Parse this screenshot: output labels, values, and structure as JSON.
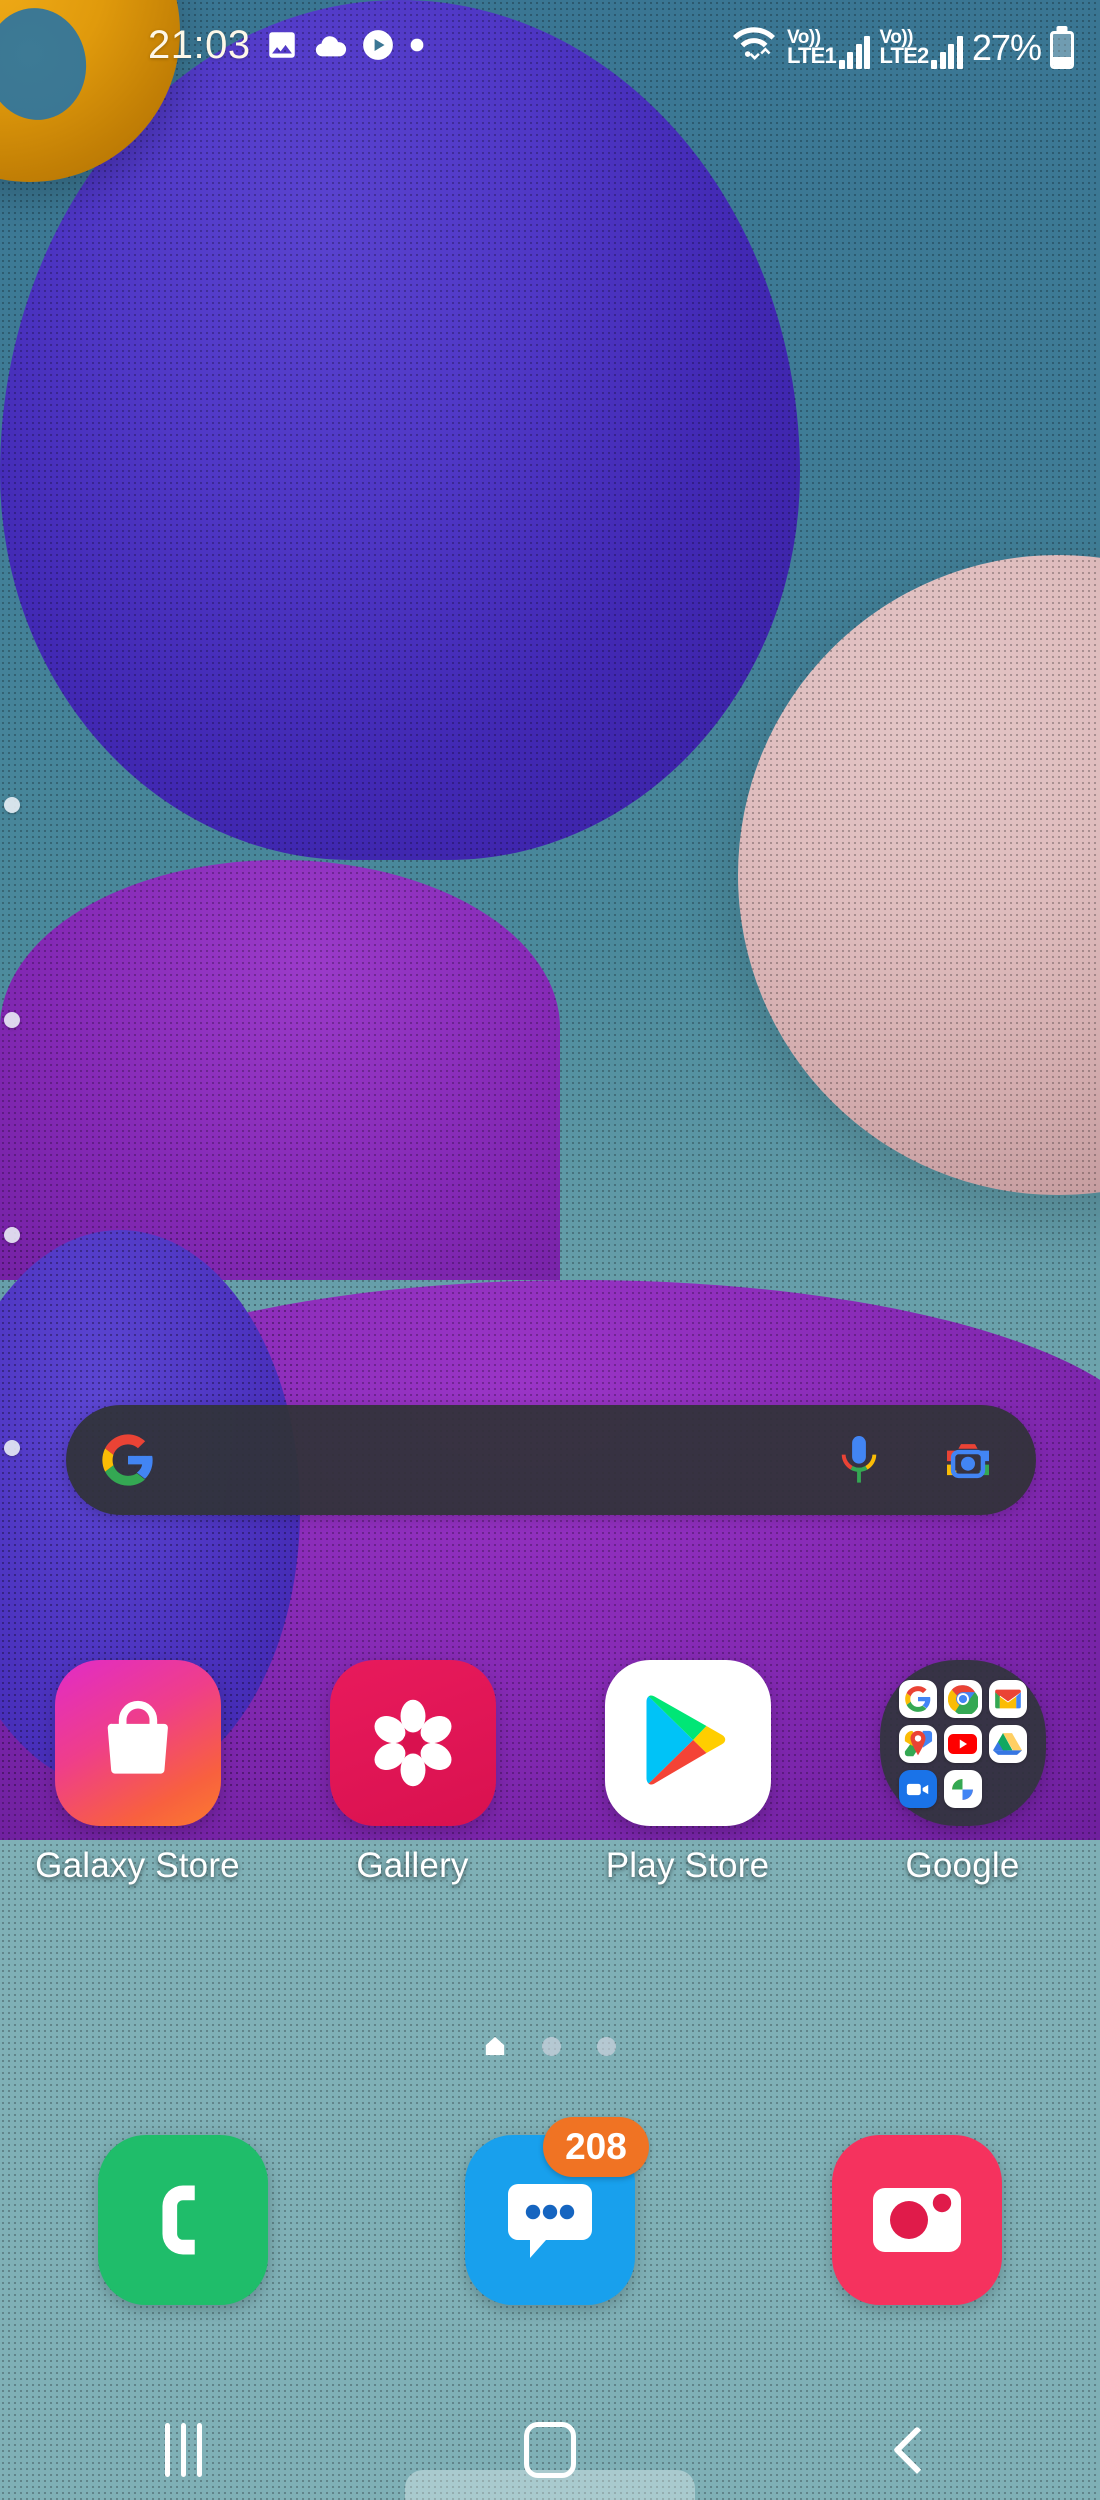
{
  "device": {
    "platform": "Android",
    "launcher": "Samsung One UI Home screen"
  },
  "status_bar": {
    "clock": "21:03",
    "notification_icons": [
      "image-icon",
      "cloud-icon",
      "play-circle-icon",
      "dot-icon"
    ],
    "wifi": "wifi-icon",
    "sims": [
      {
        "volte_top": "Vo))",
        "volte_bottom": "LTE1",
        "signal_bars": 4
      },
      {
        "volte_top": "Vo))",
        "volte_bottom": "LTE2",
        "signal_bars": 4
      }
    ],
    "battery_percent": "27%",
    "battery_level": 27
  },
  "search": {
    "placeholder": "",
    "value": "",
    "google_logo": "google-g-icon",
    "mic": "microphone-icon",
    "lens": "google-lens-icon"
  },
  "apps": [
    {
      "label": "Galaxy Store",
      "icon": "shopping-bag-icon"
    },
    {
      "label": "Gallery",
      "icon": "flower-icon"
    },
    {
      "label": "Play Store",
      "icon": "play-triangle-icon"
    },
    {
      "label": "Google",
      "icon": "folder-icon"
    }
  ],
  "google_folder": {
    "label": "Google",
    "apps": [
      "google-icon",
      "chrome-icon",
      "gmail-icon",
      "maps-icon",
      "youtube-icon",
      "drive-icon",
      "meet-icon",
      "photos-icon"
    ]
  },
  "page_indicator": {
    "pages": 3,
    "active_index": 0,
    "active_icon": "home-icon"
  },
  "dock": [
    {
      "label": "Phone",
      "icon": "phone-handset-icon",
      "badge": ""
    },
    {
      "label": "Messages",
      "icon": "speech-bubble-icon",
      "badge": "208"
    },
    {
      "label": "Camera",
      "icon": "camera-icon",
      "badge": ""
    }
  ],
  "navigation_bar": {
    "recents": "recents-icon",
    "home": "home-square-icon",
    "back": "back-chevron-icon"
  },
  "edge_panel": {
    "handle_dots": 4
  },
  "colors": {
    "search_bar_bg": "#303338",
    "galaxy_store": "#ef3e8a",
    "gallery": "#e81a5c",
    "phone": "#1fbd6a",
    "messages": "#18a0ed",
    "camera": "#f5325e",
    "badge": "#f07323",
    "wallpaper_top": "#3a7693",
    "wallpaper_purple": "#5038c6",
    "wallpaper_magenta": "#8a2cb8"
  }
}
